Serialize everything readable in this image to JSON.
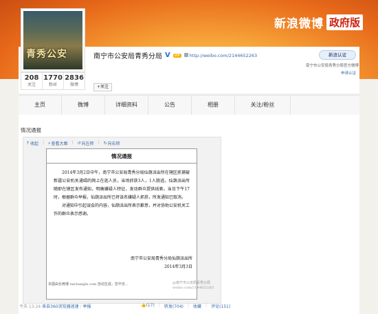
{
  "brand": {
    "name": "新浪微博",
    "gov": "政府版"
  },
  "profile": {
    "avatar_text": "青秀公安",
    "name": "南宁市公安局青秀分局",
    "verified_mark": "V",
    "vip": "VIP",
    "url": "http://weibo.com/2144652263",
    "follow": "+关注",
    "stats": [
      {
        "num": "208",
        "label": "关注"
      },
      {
        "num": "1770",
        "label": "粉丝"
      },
      {
        "num": "2836",
        "label": "微博"
      }
    ],
    "verify_button": "新浪认证",
    "verify_desc": "南宁市公安局青秀分局官方微博",
    "verify_apply": "申请认证"
  },
  "nav": [
    "主页",
    "微博",
    "详细资料",
    "公告",
    "相册",
    "关注/粉丝"
  ],
  "section_title": "情况通报",
  "post": {
    "tools": [
      "收起",
      "查看大图",
      "向左转",
      "向右转"
    ],
    "notice_title": "情况通报",
    "paragraphs": [
      "2014年3月2日中午，南宁市公安局青秀分局仙葫派出所在辖区抓捕被新疆公安机关通缉的网上在逃人员，当场抓获3人，1人脱逃。仙葫派出所随即在辖区发布通知，明确嫌疑人特征，发动群众提供线索。当日下午17时，根据群众举报，仙葫派出所已将该名嫌疑人抓获，所发通知已取消。",
      "对通知中引起误会的内容，仙葫派出所表示歉意，并对协助公安机关工作的群众表示感谢。"
    ],
    "sign_org": "南宁市公安局青秀分局仙葫派出所",
    "sign_date": "2014年3月3日",
    "watermark": "本图由长微博 taichangle.com 自动生成，您不仅…",
    "weibo_mark_1": "@南宁市公安局青秀分局",
    "weibo_mark_2": "weibo.com/2144652263",
    "time": "今天 13:24",
    "source": "来自360浏览器迷速",
    "report": "举报",
    "like": "(17)",
    "repost": "转发(704)",
    "fav": "收藏",
    "comment": "评论(151)"
  }
}
